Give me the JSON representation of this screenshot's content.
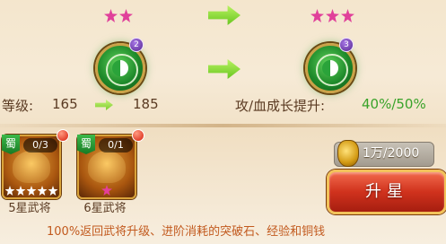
{
  "stars": {
    "current": 2,
    "next": 3,
    "color": "#e0409a"
  },
  "badges": {
    "current": "2",
    "next": "3"
  },
  "level": {
    "label": "等级:",
    "from": "165",
    "to": "185"
  },
  "growth": {
    "label": "攻/血成长提升:",
    "value": "40%/50%"
  },
  "materials": [
    {
      "faction": "蜀",
      "count": "0/3",
      "label": "5星武将",
      "stars": 5
    },
    {
      "faction": "蜀",
      "count": "0/1",
      "label": "6星武将",
      "stars": 1
    }
  ],
  "cost": {
    "value": "1万/2000",
    "icon": "gold-coin-icon"
  },
  "upgrade_button": {
    "label": "升星"
  },
  "footer": {
    "text": "100%返回武将升级、进阶消耗的突破石、经验和铜钱"
  }
}
